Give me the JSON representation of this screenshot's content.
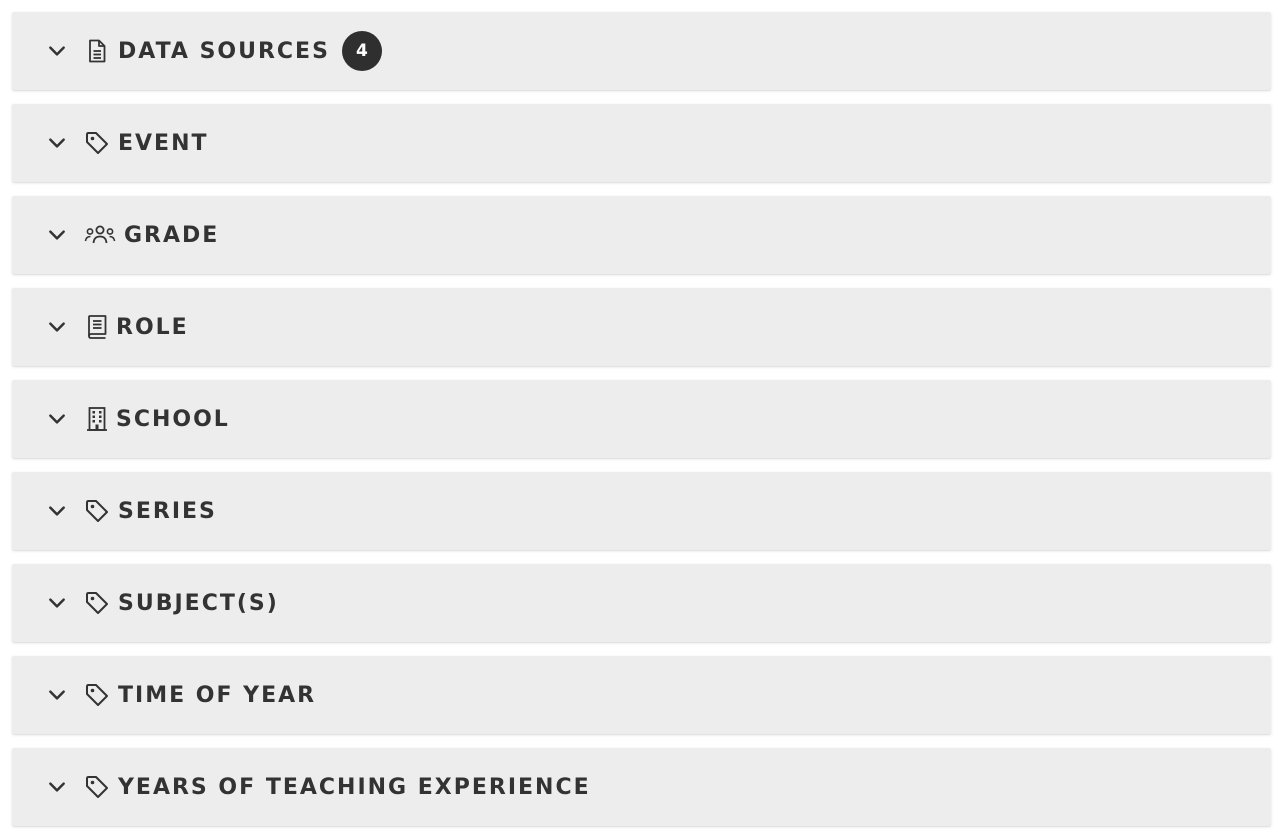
{
  "filters": [
    {
      "label": "DATA SOURCES",
      "icon": "document-icon",
      "badge": "4"
    },
    {
      "label": "EVENT",
      "icon": "tag-icon"
    },
    {
      "label": "GRADE",
      "icon": "users-icon"
    },
    {
      "label": "ROLE",
      "icon": "book-icon"
    },
    {
      "label": "SCHOOL",
      "icon": "building-icon"
    },
    {
      "label": "SERIES",
      "icon": "tag-icon"
    },
    {
      "label": "SUBJECT(S)",
      "icon": "tag-icon"
    },
    {
      "label": "TIME OF YEAR",
      "icon": "tag-icon"
    },
    {
      "label": "YEARS OF TEACHING EXPERIENCE",
      "icon": "tag-icon"
    }
  ],
  "colors": {
    "row_background": "#ededed",
    "text": "#333333",
    "badge_background": "#2f2f2f",
    "badge_text": "#ffffff"
  }
}
